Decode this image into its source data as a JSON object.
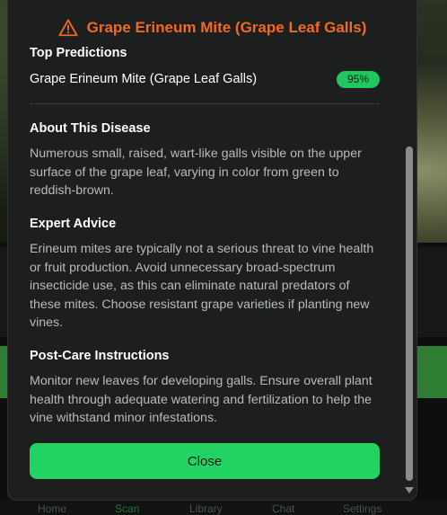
{
  "modal": {
    "title": "Grape Erineum Mite (Grape Leaf Galls)",
    "top_predictions": {
      "heading": "Top Predictions",
      "items": [
        {
          "label": "Grape Erineum Mite (Grape Leaf Galls)",
          "confidence": "95%"
        }
      ]
    },
    "about": {
      "heading": "About This Disease",
      "text": "Numerous small, raised, wart-like galls visible on the upper surface of the grape leaf, varying in color from green to reddish-brown."
    },
    "advice": {
      "heading": "Expert Advice",
      "text": "Erineum mites are typically not a serious threat to vine health or fruit production. Avoid unnecessary broad-spectrum insecticide use, as this can eliminate natural predators of these mites. Choose resistant grape varieties if planting new vines."
    },
    "post_care": {
      "heading": "Post-Care Instructions",
      "text": "Monitor new leaves for developing galls. Ensure overall plant health through adequate watering and fertilization to help the vine withstand minor infestations."
    },
    "close_label": "Close"
  },
  "bottom_nav": {
    "items": [
      "Home",
      "Scan",
      "Library",
      "Chat",
      "Settings"
    ],
    "active": "Scan"
  },
  "colors": {
    "title": "#f16a22",
    "accent": "#22d364",
    "badge": "#22c55e"
  },
  "icons": {
    "title_icon": "warning-triangle-icon"
  }
}
